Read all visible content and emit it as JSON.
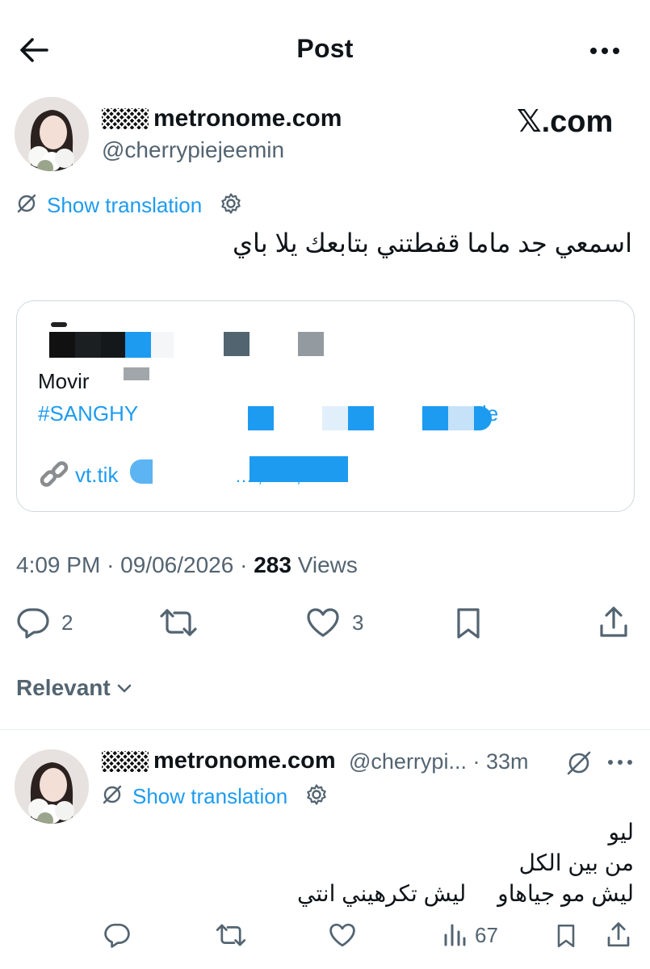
{
  "header": {
    "title": "Post"
  },
  "post": {
    "author_name": "metronome.com",
    "author_handle": "@cherrypiejeemin",
    "watermark": "𝕏.com",
    "translate_label": "Show translation",
    "text": "اسمعي جد ماما قفطتني بتابعك يلا باي",
    "quoted_card": {
      "line1": "Movir",
      "line2_start": "#SANGHYEO",
      "line2_end": "le",
      "link_start": "vt.tik",
      "link_end": "… ,Z… ,…"
    },
    "time": "4:09 PM",
    "date": "09/06/2026",
    "views_count": "283",
    "views_label": "Views",
    "reply_count": "2",
    "like_count": "3"
  },
  "filter": {
    "label": "Relevant"
  },
  "reply": {
    "author_name": "metronome.com",
    "author_handle": "@cherrypi...",
    "time": "33m",
    "translate_label": "Show translation",
    "lines": [
      "ليو",
      "من بين الكل",
      "ليش مو جياهاو     ليش تكرهيني انتي"
    ],
    "views_count": "67"
  },
  "colors": {
    "accent": "#1d9bf0",
    "secondary_text": "#536471",
    "border": "#cfd9de"
  }
}
